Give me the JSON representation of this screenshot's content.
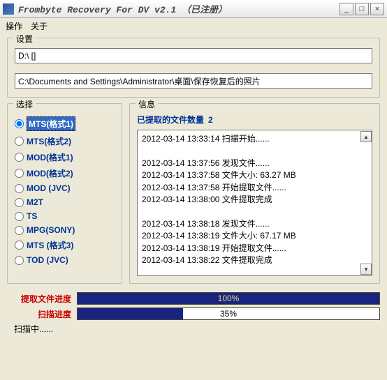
{
  "window": {
    "title": "Frombyte Recovery For DV v2.1 （已注册）"
  },
  "menu": {
    "ops": "操作",
    "about": "关于"
  },
  "settings": {
    "label": "设置",
    "path1": "D:\\ []",
    "path2": "C:\\Documents and Settings\\Administrator\\桌面\\保存恢复后的照片"
  },
  "choose": {
    "label": "选择",
    "items": [
      "MTS(格式1)",
      "MTS(格式2)",
      "MOD(格式1)",
      "MOD(格式2)",
      "MOD (JVC)",
      "M2T",
      "TS",
      "MPG(SONY)",
      "MTS (格式3)",
      "TOD (JVC)"
    ]
  },
  "info": {
    "label": "信息",
    "count_label": "已提取的文件数量",
    "count": "2",
    "log": "2012-03-14 13:33:14  扫描开始......\n\n2012-03-14 13:37:56  发现文件......\n2012-03-14 13:37:58  文件大小:  63.27 MB\n2012-03-14 13:37:58  开始提取文件......\n2012-03-14 13:38:00  文件提取完成\n\n2012-03-14 13:38:18  发现文件......\n2012-03-14 13:38:19  文件大小:  67.17 MB\n2012-03-14 13:38:19  开始提取文件......\n2012-03-14 13:38:22  文件提取完成"
  },
  "progress": {
    "extract_label": "提取文件进度",
    "extract_pct": "100%",
    "scan_label": "扫描进度",
    "scan_pct": "35%"
  },
  "status": "扫描中......"
}
